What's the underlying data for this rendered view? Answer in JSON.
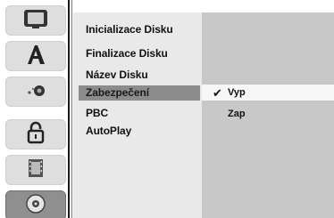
{
  "sidebar": {
    "icons": [
      {
        "name": "tv-icon"
      },
      {
        "name": "language-icon"
      },
      {
        "name": "audio-icon"
      },
      {
        "name": "lock-icon"
      },
      {
        "name": "film-icon"
      },
      {
        "name": "disc-icon"
      }
    ]
  },
  "menu": {
    "items": [
      {
        "label": "Inicializace Disku"
      },
      {
        "label": "Finalizace Disku"
      },
      {
        "label": "Název Disku"
      },
      {
        "label": "Zabezpečení"
      },
      {
        "label": "PBC"
      },
      {
        "label": "AutoPlay"
      }
    ],
    "selected_index": 3
  },
  "options": {
    "items": [
      {
        "label": "Vyp"
      },
      {
        "label": "Zap"
      }
    ],
    "checked_index": 0
  }
}
